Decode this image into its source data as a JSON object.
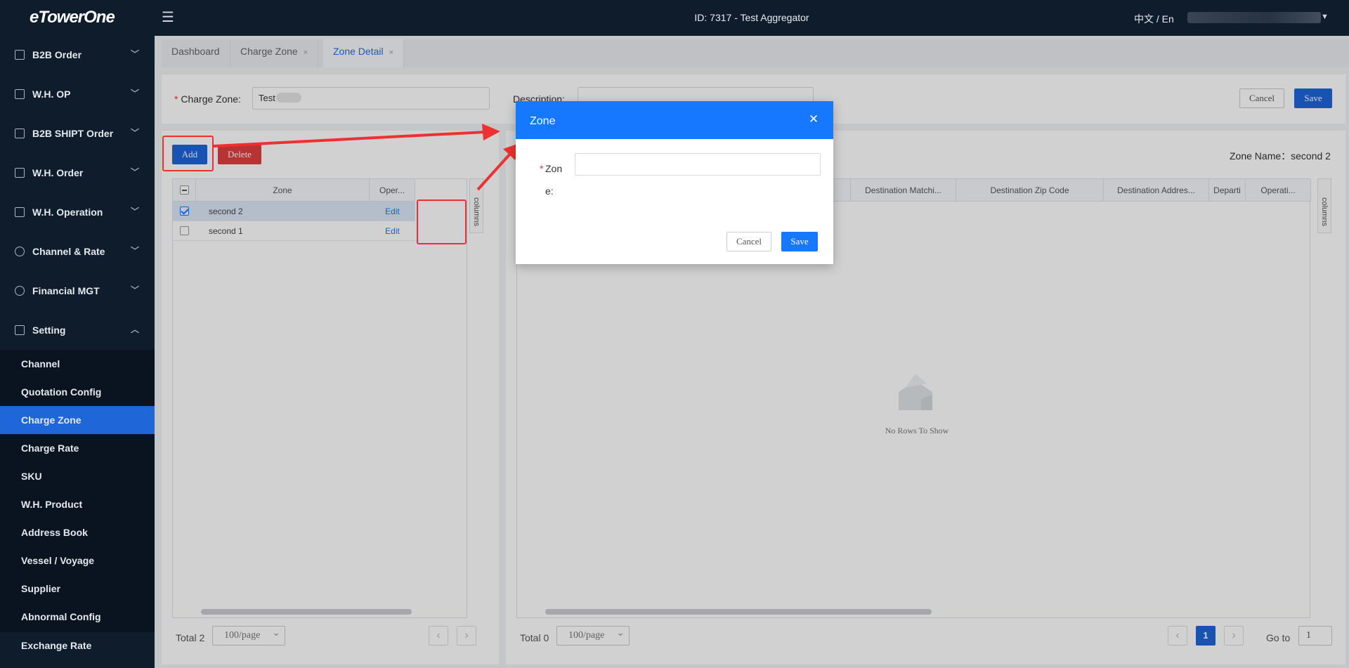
{
  "app": {
    "logo": "eTowerOne",
    "header_title": "ID: 7317 - Test Aggregator",
    "lang": "中文 / En"
  },
  "sidebar": {
    "groups": [
      {
        "label": "B2B Order",
        "icon": "b2b-order-icon"
      },
      {
        "label": "W.H. OP",
        "icon": "wh-op-icon"
      },
      {
        "label": "B2B SHIPT Order",
        "icon": "lock-icon"
      },
      {
        "label": "W.H. Order",
        "icon": "wh-order-icon"
      },
      {
        "label": "W.H. Operation",
        "icon": "warehouse-icon"
      },
      {
        "label": "Channel & Rate",
        "icon": "network-icon"
      },
      {
        "label": "Financial MGT",
        "icon": "yen-icon"
      },
      {
        "label": "Setting",
        "icon": "grid-icon"
      }
    ],
    "setting_items": [
      {
        "label": "Channel"
      },
      {
        "label": "Quotation Config"
      },
      {
        "label": "Charge Zone",
        "active": true
      },
      {
        "label": "Charge Rate"
      },
      {
        "label": "SKU"
      },
      {
        "label": "W.H. Product"
      },
      {
        "label": "Address Book"
      },
      {
        "label": "Vessel / Voyage"
      },
      {
        "label": "Supplier"
      },
      {
        "label": "Abnormal Config"
      },
      {
        "label": "Exchange Rate"
      }
    ]
  },
  "tabs": [
    {
      "label": "Dashboard",
      "closable": false
    },
    {
      "label": "Charge Zone",
      "closable": true
    },
    {
      "label": "Zone Detail",
      "closable": true,
      "active": true
    }
  ],
  "form": {
    "charge_zone_label": "Charge Zone:",
    "charge_zone_value": "Test",
    "description_label": "Description:",
    "cancel": "Cancel",
    "save": "Save"
  },
  "left_panel": {
    "add": "Add",
    "delete": "Delete",
    "columns": {
      "zone": "Zone",
      "operation": "Oper..."
    },
    "rows": [
      {
        "zone": "second 2",
        "action": "Edit",
        "checked": true
      },
      {
        "zone": "second 1",
        "action": "Edit",
        "checked": false
      }
    ],
    "columns_toggle": "columns",
    "total": "Total 2",
    "page_size": "100/page"
  },
  "right_panel": {
    "zone_name": "Zone Name：second 2",
    "columns": [
      "Destination Matchi...",
      "Destination Zip Code",
      "Destination Addres...",
      "Departi",
      "Operati..."
    ],
    "empty": "No Rows To Show",
    "columns_toggle": "columns",
    "total": "Total 0",
    "page_size": "100/page",
    "current_page": "1",
    "goto_label": "Go to",
    "goto_value": "1"
  },
  "modal": {
    "title": "Zone",
    "field_label": "Zone:",
    "cancel": "Cancel",
    "save": "Save"
  },
  "colors": {
    "sidebar_bg": "#0f1c2b",
    "accent": "#1677ff",
    "active_menu": "#1f66d8",
    "danger": "#e04040",
    "annotation": "#ee3030"
  }
}
